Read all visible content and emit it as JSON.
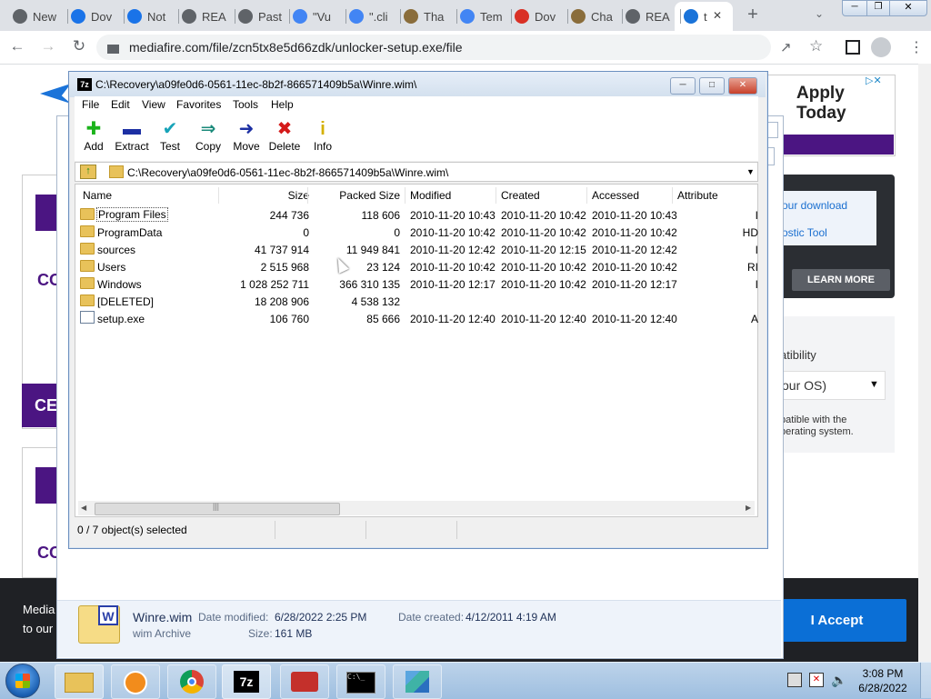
{
  "browser": {
    "tabs": [
      {
        "label": "New",
        "icon": "chrome-icon"
      },
      {
        "label": "Dov",
        "icon": "download-icon"
      },
      {
        "label": "Not",
        "icon": "cloud-icon"
      },
      {
        "label": "REA",
        "icon": "globe-icon"
      },
      {
        "label": "Past",
        "icon": "globe-icon"
      },
      {
        "label": "\"Vu",
        "icon": "google-icon"
      },
      {
        "label": "\".cli",
        "icon": "google-icon"
      },
      {
        "label": "Tha",
        "icon": "app-icon"
      },
      {
        "label": "Tem",
        "icon": "google-icon"
      },
      {
        "label": "Dov",
        "icon": "red-circle-icon"
      },
      {
        "label": "Cha",
        "icon": "app-icon"
      },
      {
        "label": "REA",
        "icon": "globe-icon"
      },
      {
        "label": "t",
        "icon": "mediafire-icon"
      }
    ],
    "url": "mediafire.com/file/zcn5tx8e5d66zdk/unlocker-setup.exe/file"
  },
  "page": {
    "ad_text": "Apply Today",
    "download_link": "our download",
    "diagnostic_link": "ostic Tool",
    "learn_more": "LEARN MORE",
    "compat_title": "atibility",
    "os_select": "our OS)",
    "compat_note_1": "patible with the",
    "compat_note_2": "perating system.",
    "cookie_text_1": "Media",
    "cookie_text_2": "to our",
    "accept": "I Accept",
    "left_co_1": "CO",
    "left_ce": "CE",
    "left_co_2": "CO"
  },
  "sevenzip": {
    "title": "C:\\Recovery\\a09fe0d6-0561-11ec-8b2f-866571409b5a\\Winre.wim\\",
    "menu": [
      "File",
      "Edit",
      "View",
      "Favorites",
      "Tools",
      "Help"
    ],
    "toolbar": [
      {
        "label": "Add",
        "icon": "plus-icon",
        "color": "#1bb31b"
      },
      {
        "label": "Extract",
        "icon": "minus-icon",
        "color": "#1c2fa3"
      },
      {
        "label": "Test",
        "icon": "check-icon",
        "color": "#17a3b8"
      },
      {
        "label": "Copy",
        "icon": "double-arrow-icon",
        "color": "#1a8a7a"
      },
      {
        "label": "Move",
        "icon": "arrow-right-icon",
        "color": "#1c2fa3"
      },
      {
        "label": "Delete",
        "icon": "x-icon",
        "color": "#d41a1a"
      },
      {
        "label": "Info",
        "icon": "info-icon",
        "color": "#d4b000"
      }
    ],
    "path": "C:\\Recovery\\a09fe0d6-0561-11ec-8b2f-866571409b5a\\Winre.wim\\",
    "columns": [
      "Name",
      "Size",
      "Packed Size",
      "Modified",
      "Created",
      "Accessed",
      "Attribute"
    ],
    "rows": [
      {
        "name": "Program Files",
        "type": "folder",
        "size": "244 736",
        "packed": "118 606",
        "modified": "2010-11-20 10:43",
        "created": "2010-11-20 10:42",
        "accessed": "2010-11-20 10:43",
        "attr": "I"
      },
      {
        "name": "ProgramData",
        "type": "folder",
        "size": "0",
        "packed": "0",
        "modified": "2010-11-20 10:42",
        "created": "2010-11-20 10:42",
        "accessed": "2010-11-20 10:42",
        "attr": "HD"
      },
      {
        "name": "sources",
        "type": "folder",
        "size": "41 737 914",
        "packed": "11 949 841",
        "modified": "2010-11-20 12:42",
        "created": "2010-11-20 12:15",
        "accessed": "2010-11-20 12:42",
        "attr": "I"
      },
      {
        "name": "Users",
        "type": "folder",
        "size": "2 515 968",
        "packed": "23 124",
        "modified": "2010-11-20 10:42",
        "created": "2010-11-20 10:42",
        "accessed": "2010-11-20 10:42",
        "attr": "RI"
      },
      {
        "name": "Windows",
        "type": "folder",
        "size": "1 028 252 711",
        "packed": "366 310 135",
        "modified": "2010-11-20 12:17",
        "created": "2010-11-20 10:42",
        "accessed": "2010-11-20 12:17",
        "attr": "I"
      },
      {
        "name": "[DELETED]",
        "type": "folder",
        "size": "18 208 906",
        "packed": "4 538 132",
        "modified": "",
        "created": "",
        "accessed": "",
        "attr": ""
      },
      {
        "name": "setup.exe",
        "type": "file",
        "size": "106 760",
        "packed": "85 666",
        "modified": "2010-11-20 12:40",
        "created": "2010-11-20 12:40",
        "accessed": "2010-11-20 12:40",
        "attr": "A"
      }
    ],
    "status": "0 / 7 object(s) selected"
  },
  "explorer_details": {
    "filename": "Winre.wim",
    "type": "wim Archive",
    "modified_label": "Date modified:",
    "modified_value": "6/28/2022 2:25 PM",
    "size_label": "Size:",
    "size_value": "161 MB",
    "created_label": "Date created:",
    "created_value": "4/12/2011 4:19 AM"
  },
  "taskbar": {
    "time": "3:08 PM",
    "date": "6/28/2022"
  },
  "colors": {
    "accent_purple": "#4b1582",
    "accept_blue": "#0b6fd6"
  }
}
